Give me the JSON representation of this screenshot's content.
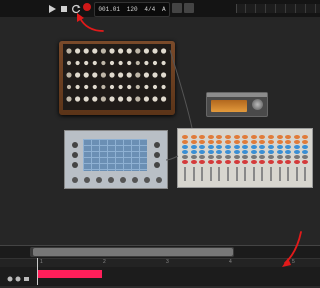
{
  "transport": {
    "buttons": [
      "play",
      "stop",
      "loop",
      "record"
    ],
    "lcd": {
      "position": "001.01",
      "tempo": "120",
      "time_signature": "4/4",
      "key": "A"
    }
  },
  "timeline": {
    "ruler_labels": [
      "1",
      "2",
      "3",
      "4",
      "5"
    ],
    "clip_color": "#ff1f5a"
  },
  "colors": {
    "annotation_arrow": "#e11a1a",
    "record": "#d01818",
    "synth_wood": "#6b3d1f",
    "module_display": "#d88a2e"
  }
}
